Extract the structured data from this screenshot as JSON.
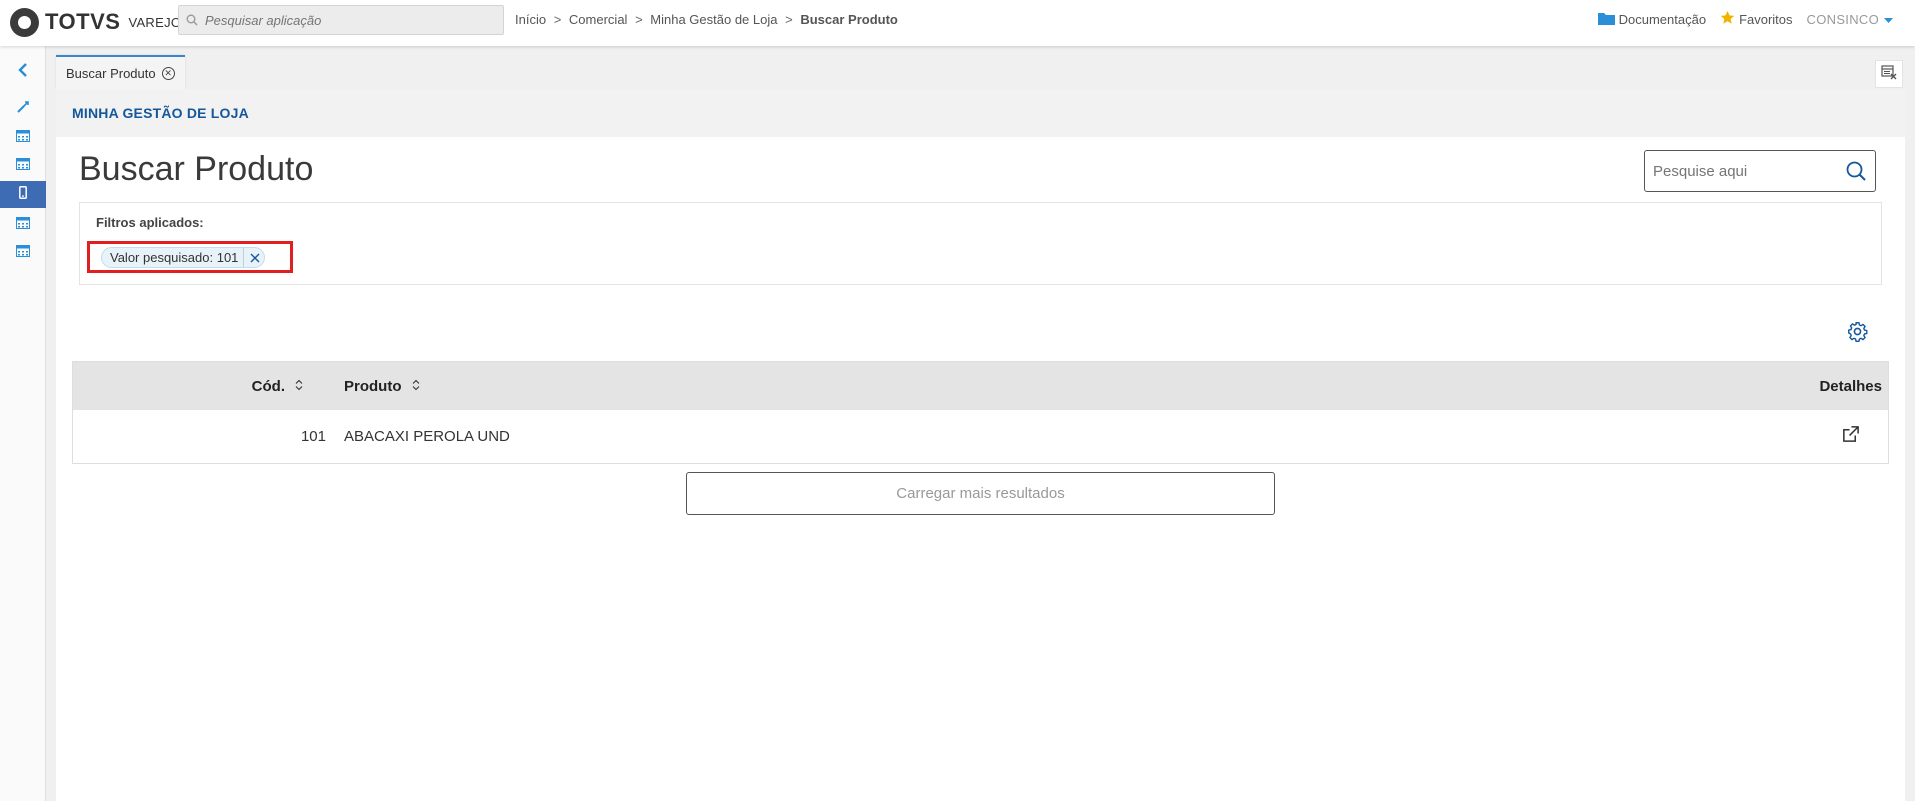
{
  "topbar": {
    "brand": "TOTVS",
    "brand_sub": "VAREJO",
    "search_placeholder": "Pesquisar aplicação",
    "breadcrumb": [
      "Início",
      "Comercial",
      "Minha Gestão de Loja",
      "Buscar Produto"
    ],
    "breadcrumb_sep": ">",
    "docs_label": "Documentação",
    "favorites_label": "Favoritos",
    "user_label": "CONSINCO"
  },
  "sidebar": {
    "items": [
      {
        "icon": "chevron-left-icon"
      },
      {
        "icon": "wrench-icon"
      },
      {
        "icon": "table-icon"
      },
      {
        "icon": "table-icon"
      },
      {
        "icon": "mobile-icon",
        "active": true
      },
      {
        "icon": "table-icon"
      },
      {
        "icon": "table-icon"
      }
    ]
  },
  "tabs": [
    {
      "label": "Buscar Produto",
      "active": true
    }
  ],
  "panel": {
    "module_title": "MINHA GESTÃO DE LOJA",
    "page_title": "Buscar Produto",
    "search_placeholder": "Pesquise aqui",
    "filters_label": "Filtros aplicados:",
    "filter_chip": "Valor pesquisado: 101"
  },
  "table": {
    "columns": [
      "Cód.",
      "Produto",
      "Detalhes"
    ],
    "rows": [
      {
        "code": "101",
        "product": "ABACAXI PEROLA UND"
      }
    ]
  },
  "load_more_label": "Carregar mais resultados",
  "colors": {
    "accent": "#3b86c9",
    "sidebar_active": "#3d6cb4",
    "module_title": "#14579a",
    "highlight_frame": "#e02020"
  }
}
